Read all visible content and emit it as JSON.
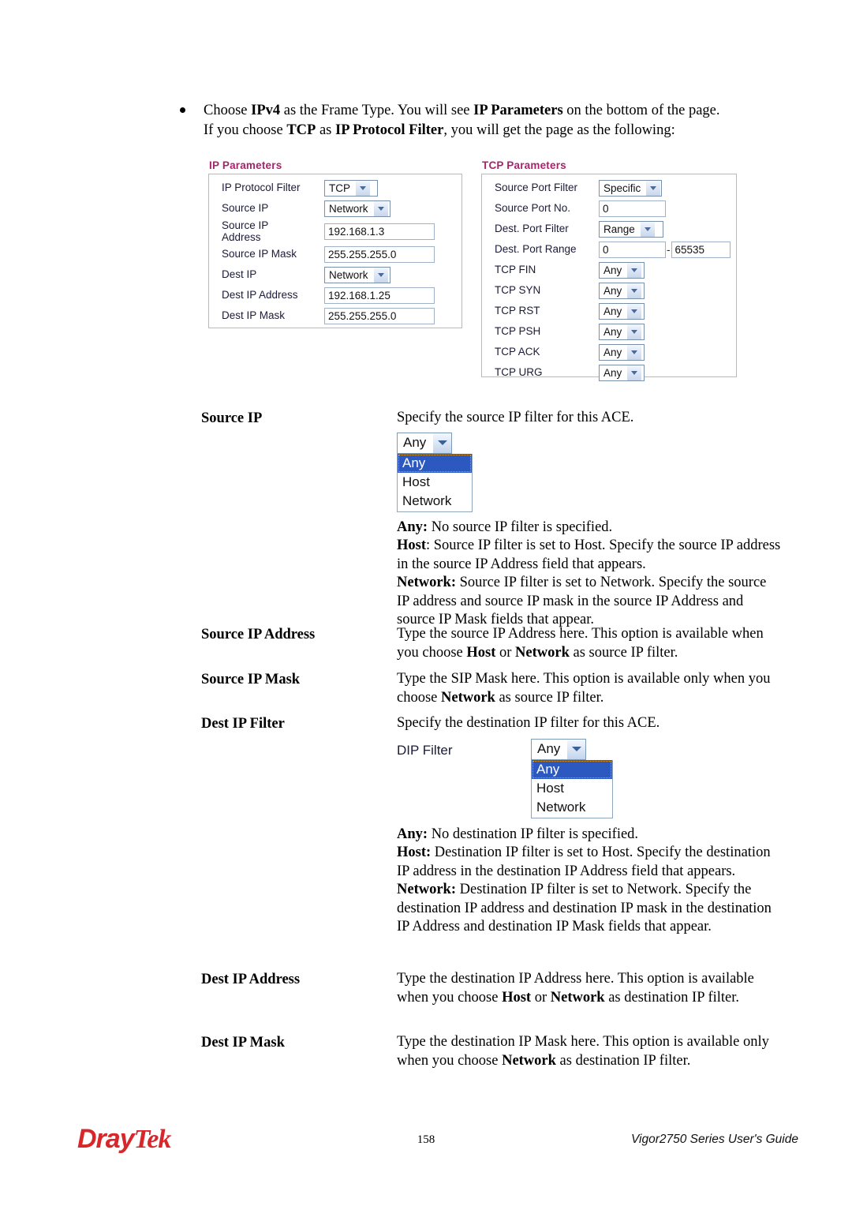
{
  "intro": {
    "bullet_icon": "bullet-point",
    "line1_a": "Choose ",
    "line1_b": "IPv4",
    "line1_c": " as the Frame Type. You will see ",
    "line1_d": "IP Parameters",
    "line1_e": " on the bottom of the page.",
    "line2_a": "If you choose ",
    "line2_b": "TCP",
    "line2_c": " as ",
    "line2_d": "IP Protocol Filter",
    "line2_e": ", you will get the page as the following:"
  },
  "ip_parameters": {
    "title": "IP Parameters",
    "rows": [
      {
        "label": "IP Protocol Filter",
        "control": "select",
        "value": "TCP"
      },
      {
        "label": "Source IP",
        "control": "select",
        "value": "Network"
      },
      {
        "label": "Source IP Address",
        "control": "text",
        "value": "192.168.1.3"
      },
      {
        "label": "Source IP Mask",
        "control": "text",
        "value": "255.255.255.0"
      },
      {
        "label": "Dest IP",
        "control": "select",
        "value": "Network"
      },
      {
        "label": "Dest IP Address",
        "control": "text",
        "value": "192.168.1.25"
      },
      {
        "label": "Dest IP Mask",
        "control": "text",
        "value": "255.255.255.0"
      }
    ]
  },
  "tcp_parameters": {
    "title": "TCP Parameters",
    "rows": [
      {
        "label": "Source Port Filter",
        "control": "select",
        "value": "Specific"
      },
      {
        "label": "Source Port No.",
        "control": "text",
        "value": "0"
      },
      {
        "label": "Dest. Port Filter",
        "control": "select",
        "value": "Range"
      },
      {
        "label": "Dest. Port Range",
        "control": "range",
        "value": "0",
        "value2": "65535",
        "separator": "-"
      },
      {
        "label": "TCP FIN",
        "control": "select",
        "value": "Any"
      },
      {
        "label": "TCP SYN",
        "control": "select",
        "value": "Any"
      },
      {
        "label": "TCP RST",
        "control": "select",
        "value": "Any"
      },
      {
        "label": "TCP PSH",
        "control": "select",
        "value": "Any"
      },
      {
        "label": "TCP ACK",
        "control": "select",
        "value": "Any"
      },
      {
        "label": "TCP URG",
        "control": "select",
        "value": "Any"
      }
    ]
  },
  "definitions": {
    "source_ip": {
      "term": "Source IP",
      "desc_intro": "Specify the source IP filter for this ACE.",
      "dropdown": {
        "selected": "Any",
        "options": [
          "Any",
          "Host",
          "Network"
        ]
      },
      "notes": [
        {
          "bold": "Any:",
          "text": " No source IP filter is specified."
        },
        {
          "bold": "Host",
          "text": ": Source IP filter is set to Host. Specify the source IP address in the source IP Address field that appears."
        },
        {
          "bold": "Network:",
          "text": " Source IP filter is set to Network. Specify the source IP address and source IP mask in the source IP Address and source IP Mask fields that appear."
        }
      ]
    },
    "source_ip_address": {
      "term": "Source IP Address",
      "p1": "Type the source IP Address here. This option is available when you choose ",
      "b1": "Host",
      "p2": " or ",
      "b2": "Network",
      "p3": " as source IP filter."
    },
    "source_ip_mask": {
      "term": "Source IP Mask",
      "p1": "Type the SIP Mask here. This option is available only when you choose ",
      "b1": "Network",
      "p2": " as source IP filter."
    },
    "dest_ip_filter": {
      "term": "Dest IP Filter",
      "desc_intro": "Specify the destination IP filter for this ACE.",
      "field_label": "DIP Filter",
      "dropdown": {
        "selected": "Any",
        "options": [
          "Any",
          "Host",
          "Network"
        ]
      },
      "notes": [
        {
          "bold": "Any:",
          "text": " No destination IP filter is specified."
        },
        {
          "bold": "Host:",
          "text": " Destination IP filter is set to Host. Specify the destination IP address in the destination IP Address field that appears."
        },
        {
          "bold": "Network:",
          "text": " Destination IP filter is set to Network. Specify the destination IP address and destination IP mask in the destination IP Address and destination IP Mask fields that appear."
        }
      ]
    },
    "dest_ip_address": {
      "term": "Dest IP Address",
      "p1": "Type the destination IP Address here. This option is available when you choose ",
      "b1": "Host",
      "p2": " or ",
      "b2": "Network",
      "p3": " as destination IP filter."
    },
    "dest_ip_mask": {
      "term": "Dest IP Mask",
      "p1": "Type the destination IP Mask here. This option is available only when you choose ",
      "b1": "Network",
      "p2": " as destination IP filter."
    }
  },
  "footer": {
    "logo_dray": "Dray",
    "logo_tek": "Tek",
    "page_number": "158",
    "guide": "Vigor2750 Series User's Guide"
  },
  "colors": {
    "panel_title": "#a8236b",
    "dropdown_highlight": "#2c59c0",
    "logo_red": "#d8262a"
  }
}
